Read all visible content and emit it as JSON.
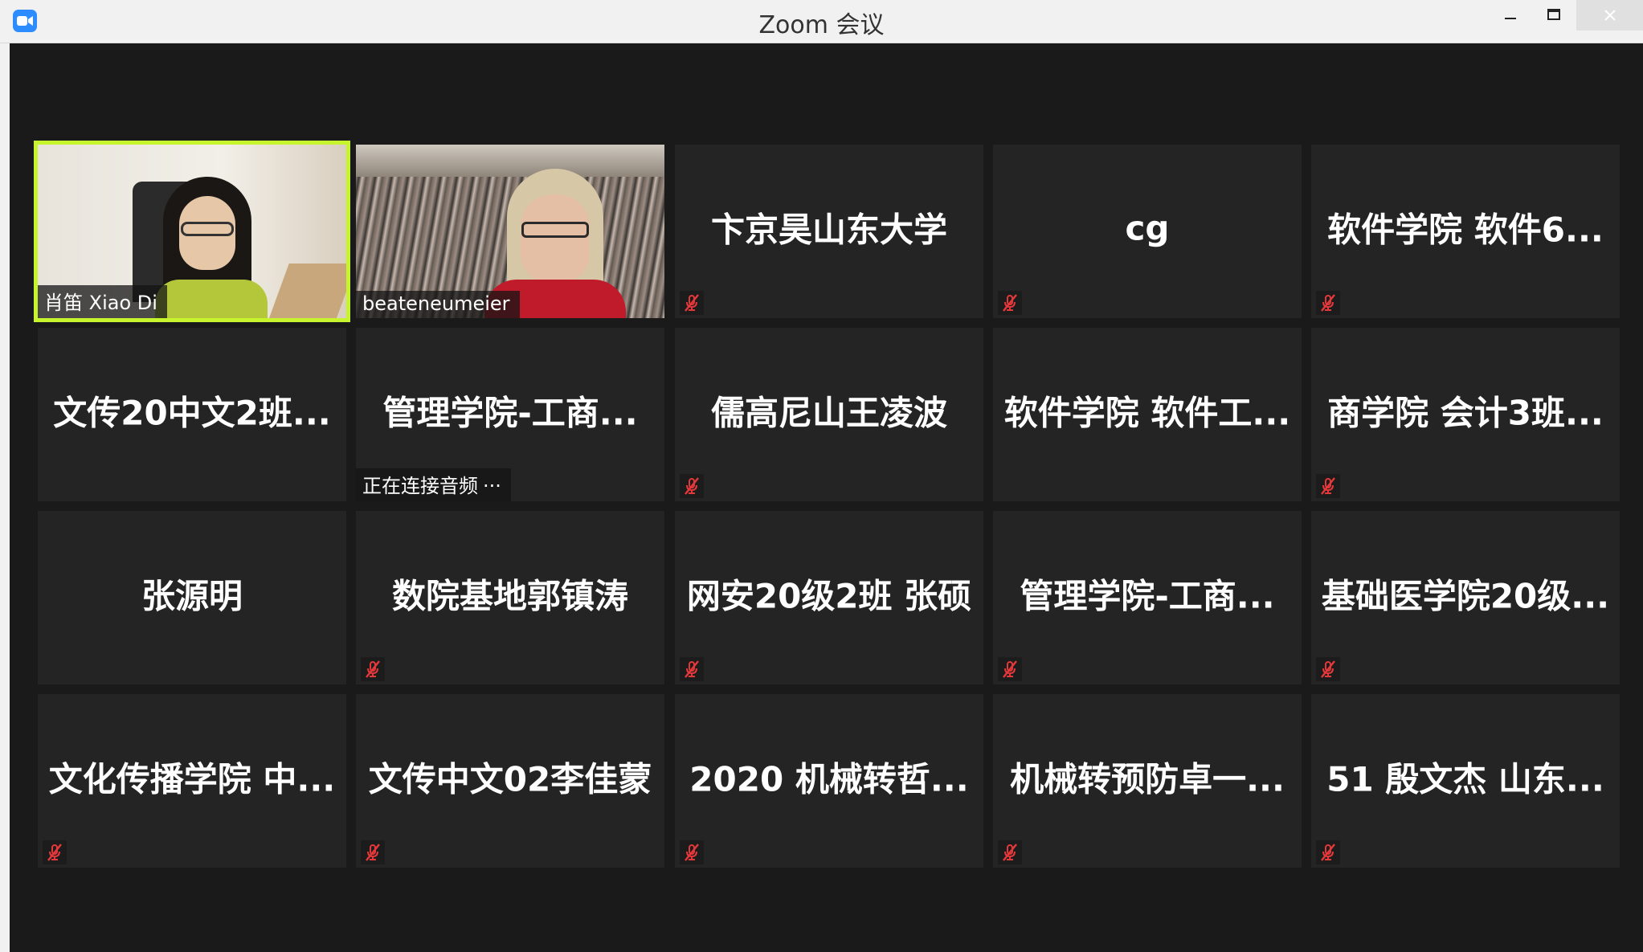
{
  "window": {
    "title": "Zoom 会议"
  },
  "tiles": [
    {
      "name": "肖笛 Xiao Di",
      "video": true,
      "active": true,
      "muted": false
    },
    {
      "name": "beateneumeier",
      "video": true,
      "active": false,
      "muted": false
    },
    {
      "name": "卞京昊山东大学",
      "muted": true
    },
    {
      "name": "cg",
      "muted": true
    },
    {
      "name": "软件学院 软件6...",
      "muted": true
    },
    {
      "name": "文传20中文2班...",
      "muted": false
    },
    {
      "name": "管理学院-工商...",
      "muted": false,
      "status": "正在连接音频",
      "status_dots": "···"
    },
    {
      "name": "儒高尼山王凌波",
      "muted": true
    },
    {
      "name": "软件学院 软件工...",
      "muted": false
    },
    {
      "name": "商学院 会计3班...",
      "muted": true
    },
    {
      "name": "张源明",
      "muted": false
    },
    {
      "name": "数院基地郭镇涛",
      "muted": true
    },
    {
      "name": "网安20级2班 张硕",
      "muted": true
    },
    {
      "name": "管理学院-工商...",
      "muted": true
    },
    {
      "name": "基础医学院20级...",
      "muted": true
    },
    {
      "name": "文化传播学院 中...",
      "muted": true
    },
    {
      "name": "文传中文02李佳蒙",
      "muted": true
    },
    {
      "name": "2020 机械转哲...",
      "muted": true
    },
    {
      "name": "机械转预防卓一...",
      "muted": true
    },
    {
      "name": "51 殷文杰 山东...",
      "muted": true
    }
  ],
  "colors": {
    "active_border": "#c6f52d",
    "mute_icon": "#e5383b",
    "tile_bg": "#242424",
    "zoom_blue": "#2d8cff"
  },
  "icons": {
    "app": "zoom-camera-icon",
    "mute": "mic-muted-icon",
    "minimize": "minimize-icon",
    "maximize": "maximize-icon",
    "close": "close-icon"
  }
}
